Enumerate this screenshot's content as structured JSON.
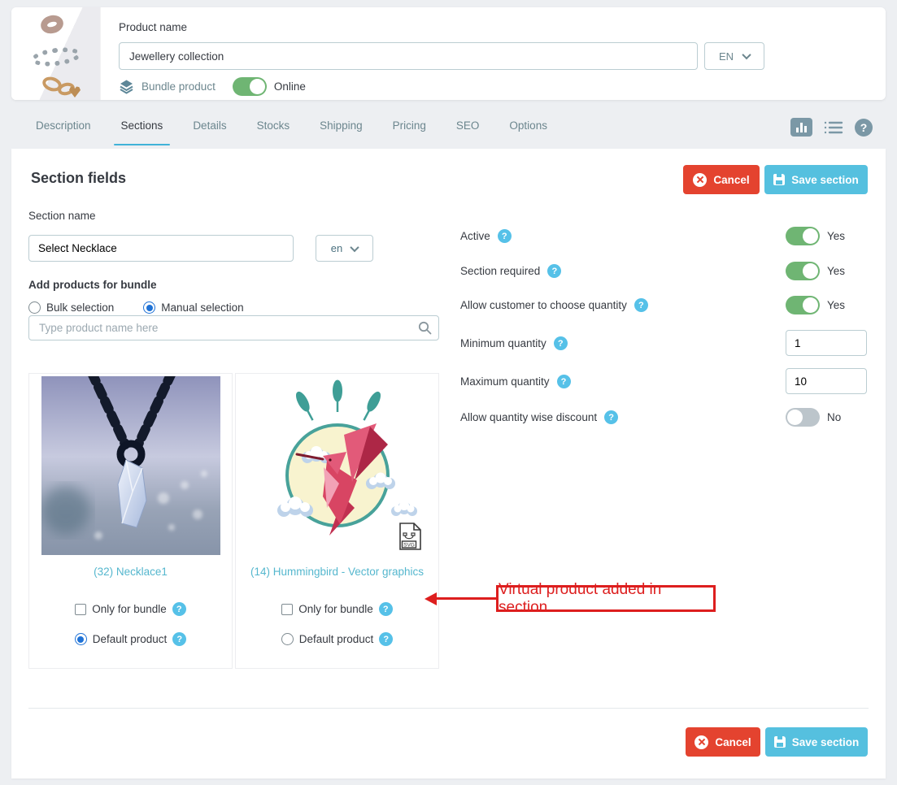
{
  "header": {
    "product_name_label": "Product name",
    "product_name_value": "Jewellery collection",
    "language_selected": "EN",
    "product_type_label": "Bundle product",
    "online_label": "Online"
  },
  "tabs": {
    "items": [
      "Description",
      "Sections",
      "Details",
      "Stocks",
      "Shipping",
      "Pricing",
      "SEO",
      "Options"
    ],
    "active": "Sections"
  },
  "toolbar": {
    "icons": [
      "bar-chart-icon",
      "list-icon",
      "help-icon"
    ]
  },
  "section": {
    "title": "Section fields",
    "cancel_label": "Cancel",
    "save_label": "Save section",
    "name_label": "Section name",
    "name_value": "Select Necklace",
    "name_language": "en",
    "add_products_label": "Add products for bundle",
    "bulk_selection_label": "Bulk selection",
    "manual_selection_label": "Manual selection",
    "selection_mode": "manual",
    "search_placeholder": "Type product name here"
  },
  "products": [
    {
      "caption": "(32) Necklace1",
      "only_for_bundle_label": "Only for bundle",
      "only_for_bundle_checked": false,
      "default_product_label": "Default product",
      "default_product_selected": true
    },
    {
      "caption": "(14) Hummingbird - Vector graphics",
      "only_for_bundle_label": "Only for bundle",
      "only_for_bundle_checked": false,
      "default_product_label": "Default product",
      "default_product_selected": false,
      "file_badge": "SVG"
    }
  ],
  "settings": {
    "active": {
      "label": "Active",
      "value": "Yes"
    },
    "section_required": {
      "label": "Section required",
      "value": "Yes"
    },
    "allow_choose_quantity": {
      "label": "Allow customer to choose quantity",
      "value": "Yes"
    },
    "minimum_quantity": {
      "label": "Minimum quantity",
      "value": "1"
    },
    "maximum_quantity": {
      "label": "Maximum quantity",
      "value": "10"
    },
    "allow_quantity_discount": {
      "label": "Allow quantity wise discount",
      "value": "No"
    }
  },
  "footer": {
    "cancel_label": "Cancel",
    "save_label": "Save section"
  },
  "annotation": {
    "text": "Virtual product added in section"
  },
  "colors": {
    "accent_red": "#e4432f",
    "accent_blue": "#55c0df",
    "toggle_green": "#6fb573",
    "toggle_gray": "#bcc5cb",
    "help_blue": "#56c1e8",
    "tab_underline": "#40b2d8",
    "caption_blue": "#55b7ce",
    "annotation_red": "#dd1e1e"
  }
}
